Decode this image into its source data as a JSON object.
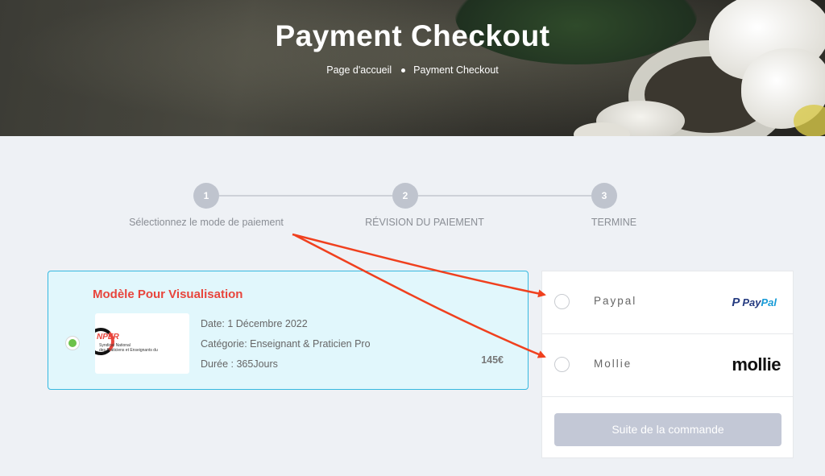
{
  "hero": {
    "title": "Payment Checkout",
    "breadcrumb": [
      "Page d'accueil",
      "Payment Checkout"
    ]
  },
  "steps": [
    {
      "number": "1",
      "label": "Sélectionnez le mode de paiement"
    },
    {
      "number": "2",
      "label": "RÉVISION DU PAIEMENT"
    },
    {
      "number": "3",
      "label": "TERMINE"
    }
  ],
  "product": {
    "title": "Modèle Pour Visualisation",
    "logo_text": "NPER",
    "logo_sub1": "Syndicat National",
    "logo_sub2": "des Praticiens et Enseignants du",
    "date": "Date: 1 Décembre 2022",
    "category": "Catégorie: Enseignant & Praticien Pro",
    "duration": "Durée : 365Jours",
    "price": "145€",
    "selected": true
  },
  "payment": {
    "methods": [
      {
        "label": "Paypal",
        "logo_icon": "P",
        "logo_pay": "Pay",
        "logo_pal": "Pal"
      },
      {
        "label": "Mollie",
        "logo": "mollie"
      }
    ],
    "submit_label": "Suite de la commande"
  },
  "colors": {
    "accent_red": "#e8453c",
    "card_border": "#35b8e0",
    "card_bg": "#e1f7fc",
    "selected_green": "#6cc24a",
    "button_disabled": "#c3c8d6",
    "arrow": "#f0401e"
  }
}
